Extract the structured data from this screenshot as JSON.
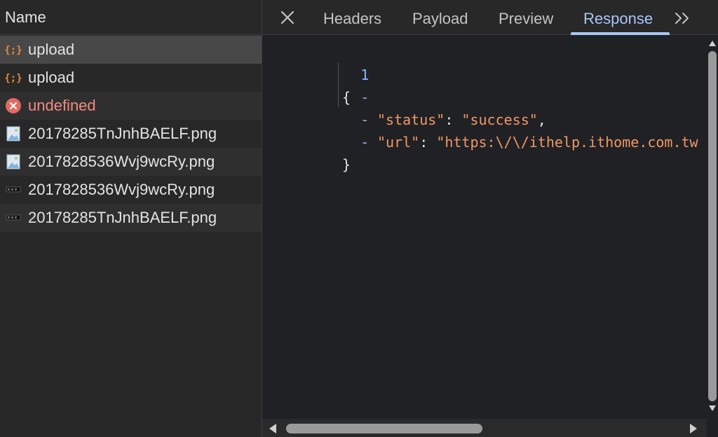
{
  "requests_panel": {
    "column_header": "Name",
    "rows": [
      {
        "name": "upload",
        "icon": "json-braces-icon",
        "state": "selected"
      },
      {
        "name": "upload",
        "icon": "json-braces-icon",
        "state": "normal"
      },
      {
        "name": "undefined",
        "icon": "error-circle-icon",
        "state": "error"
      },
      {
        "name": "20178285TnJnhBAELF.png",
        "icon": "image-file-icon",
        "state": "normal"
      },
      {
        "name": "2017828536Wvj9wcRy.png",
        "icon": "image-file-icon",
        "state": "normal"
      },
      {
        "name": "2017828536Wvj9wcRy.png",
        "icon": "image-thumbnail-icon",
        "state": "normal"
      },
      {
        "name": "20178285TnJnhBAELF.png",
        "icon": "image-thumbnail-icon",
        "state": "normal"
      }
    ]
  },
  "detail_panel": {
    "tabs": [
      "Headers",
      "Payload",
      "Preview",
      "Response"
    ],
    "active_tab": "Response",
    "close_icon": "close-icon",
    "more_icon": "chevron-double-right-icon"
  },
  "response": {
    "lines": [
      {
        "gutter": "1",
        "open": "{"
      },
      {
        "gutter": "-",
        "key": "\"status\"",
        "sep": ": ",
        "value": "\"success\"",
        "tail": ","
      },
      {
        "gutter": "-",
        "key": "\"url\"",
        "sep": ": ",
        "value": "\"https:\\/\\/ithelp.ithome.com.tw",
        "tail": ""
      },
      {
        "gutter": "-",
        "close": "}"
      }
    ]
  },
  "colors": {
    "accent": "#a8c7fa",
    "json_string": "#f29766",
    "error": "#f28b82",
    "json_icon": "#e8893c"
  }
}
